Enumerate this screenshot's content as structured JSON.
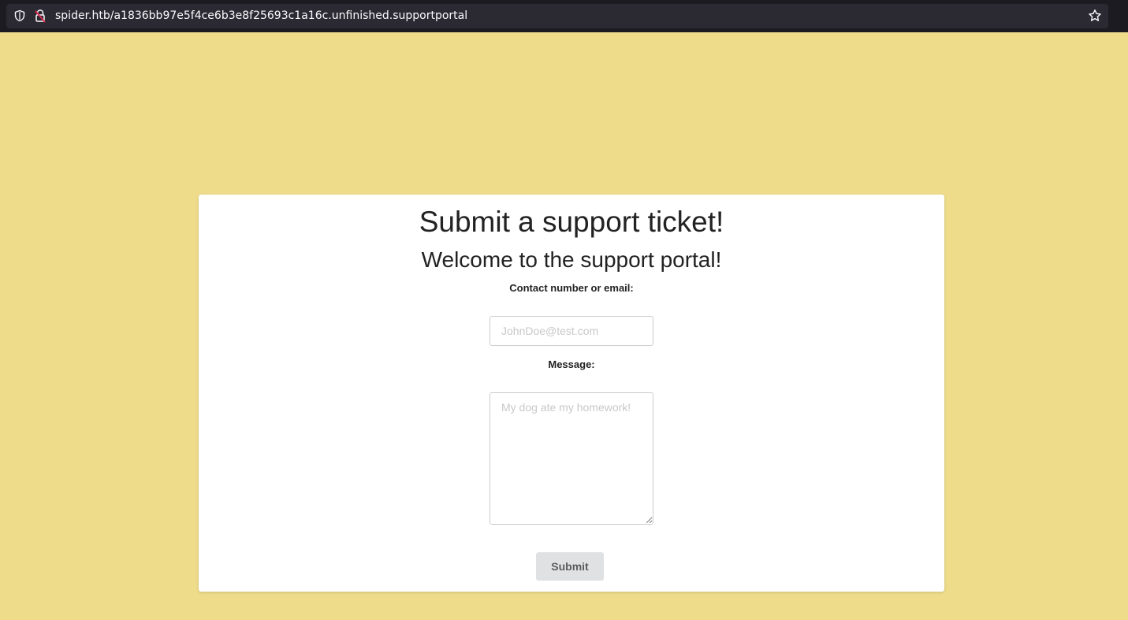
{
  "browser": {
    "url": "spider.htb/a1836bb97e5f4ce6b3e8f25693c1a16c.unfinished.supportportal",
    "icons": [
      "shield-icon",
      "insecure-lock-icon",
      "bookmark-star-icon"
    ],
    "colors": {
      "bar": "#1c1b22",
      "url_field": "#2b2a33",
      "insecure_accent": "#e22850"
    }
  },
  "page": {
    "background": "#eedc8b"
  },
  "form": {
    "title": "Submit a support ticket!",
    "subtitle": "Welcome to the support portal!",
    "contact_label": "Contact number or email:",
    "contact_placeholder": "JohnDoe@test.com",
    "contact_value": "",
    "message_label": "Message:",
    "message_placeholder": "My dog ate my homework!",
    "message_value": "",
    "submit_label": "Submit"
  }
}
